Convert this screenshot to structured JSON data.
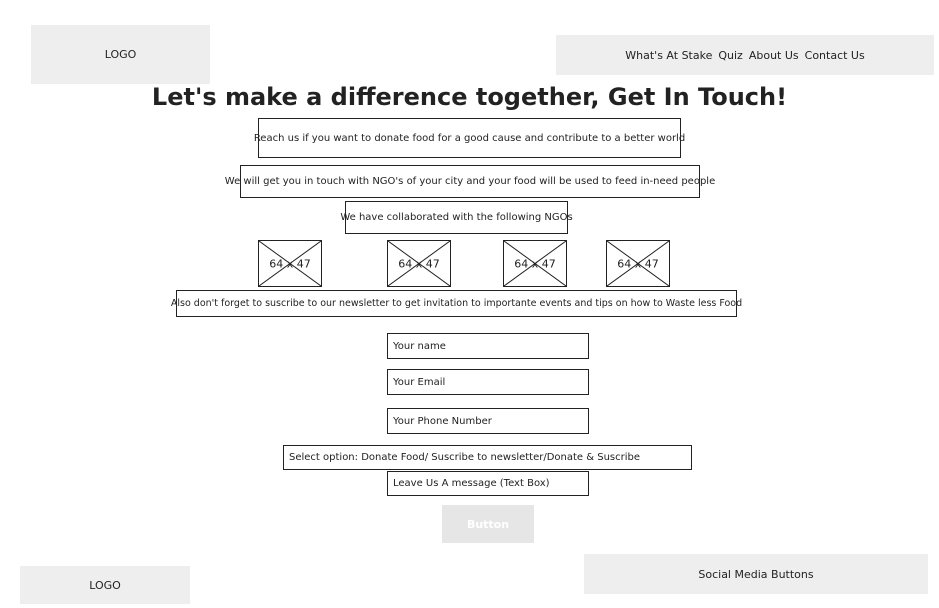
{
  "header": {
    "logo": "LOGO",
    "nav": [
      "What's At Stake",
      "Quiz",
      "About Us",
      "Contact Us"
    ]
  },
  "main": {
    "title": "Let's make a difference together, Get In Touch!",
    "intro": "Reach us if you want to donate food for a good cause and contribute to a better world",
    "connect": "We will get you in touch with NGO's of your city and your food will be used to feed in-need people",
    "collab": "We have collaborated with the following NGOs",
    "ngo_images": [
      "64 x 47",
      "64 x 47",
      "64 x 47",
      "64 x 47"
    ],
    "newsletter": "Also don't forget to suscribe to our newsletter to get invitation to importante events and tips on how to Waste less Food"
  },
  "form": {
    "name": "Your name",
    "email": "Your Email",
    "phone": "Your Phone Number",
    "select": "Select option: Donate Food/ Suscribe to newsletter/Donate & Suscribe",
    "message": "Leave Us A message (Text Box)",
    "button": "Button"
  },
  "footer": {
    "logo": "LOGO",
    "social": "Social Media Buttons"
  }
}
